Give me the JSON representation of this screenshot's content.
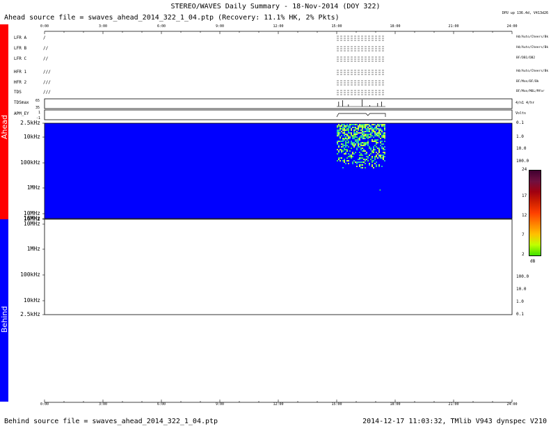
{
  "header": {
    "title": "STEREO/WAVES Daily Summary - 18-Nov-2014 (DOY 322)",
    "ahead_source": "Ahead source file = swaves_ahead_2014_322_1_04.ptp (Recovery: 11.1% HK,  2% Pkts)",
    "dpu_info": "DPU up 136.4d, V413d26"
  },
  "sides": {
    "ahead": "Ahead",
    "behind": "Behind",
    "ahead_color": "#ff0000",
    "behind_color": "#0000ff"
  },
  "time_axis": {
    "ticks": [
      "0:00",
      "3:00",
      "6:00",
      "9:00",
      "12:00",
      "15:00",
      "18:00",
      "21:00",
      "24:00"
    ]
  },
  "instruments": [
    {
      "label": "LFR A",
      "marks": "/"
    },
    {
      "label": "LFR B",
      "marks": "//"
    },
    {
      "label": "LFR C",
      "marks": "//"
    },
    {
      "label": "HFR 1",
      "marks": "///"
    },
    {
      "label": "HFR 2",
      "marks": "///"
    },
    {
      "label": "TDS",
      "marks": "///"
    }
  ],
  "small_panels": {
    "tdsmax": {
      "label": "TDSmax",
      "ticks": [
        "65",
        "35"
      ],
      "right": "4/n1 4/hr"
    },
    "apm": {
      "label": "APM_EY",
      "ticks": [
        "1",
        "-1"
      ],
      "right": "Volts"
    }
  },
  "right_annotations": [
    "Hd/Auto/Cheers/Bk",
    "Hd/Auto/Cheers/Bk",
    "BF/DB1/DB2",
    "Hd/Auto/Cheers/Bk",
    "BF/Mon/BF/Bk",
    "BF/Mon/MOL/Mfor"
  ],
  "ahead_freq_labels": [
    "2.5kHz",
    "10kHz",
    "100kHz",
    "1MHz",
    "10MHz",
    "16MHz"
  ],
  "ahead_right_labels": [
    "0.1",
    "1.0",
    "10.0",
    "100.0"
  ],
  "behind_freq_labels": [
    "16MHz",
    "10MHz",
    "1MHz",
    "100kHz",
    "10kHz",
    "2.5kHz"
  ],
  "behind_right_labels": [
    "100.0",
    "10.0",
    "1.0",
    "0.1"
  ],
  "colorbar": {
    "ticks": [
      "24",
      "17",
      "12",
      "7",
      "2"
    ],
    "unit": "dB",
    "colors": [
      "#400030",
      "#701040",
      "#a00010",
      "#d02000",
      "#ff4000",
      "#ff8000",
      "#ffc000",
      "#c0ff00",
      "#40e000"
    ]
  },
  "chart_data": [
    {
      "type": "heatmap",
      "title": "Ahead",
      "x_ticks": [
        "0:00",
        "3:00",
        "6:00",
        "9:00",
        "12:00",
        "15:00",
        "18:00",
        "21:00",
        "24:00"
      ],
      "xlim_hours": [
        0,
        24
      ],
      "y_ticks": [
        "2.5kHz",
        "10kHz",
        "100kHz",
        "1MHz",
        "10MHz",
        "16MHz"
      ],
      "background_color": "#0000ff",
      "data_interval_hours": [
        15.0,
        17.5
      ],
      "colorbar_db": [
        2,
        24
      ]
    },
    {
      "type": "heatmap",
      "title": "Behind",
      "x_ticks": [
        "0:00",
        "3:00",
        "6:00",
        "9:00",
        "12:00",
        "15:00",
        "18:00",
        "21:00",
        "24:00"
      ],
      "xlim_hours": [
        0,
        24
      ],
      "y_ticks": [
        "16MHz",
        "10MHz",
        "1MHz",
        "100kHz",
        "10kHz",
        "2.5kHz"
      ],
      "background_color": "#ffffff"
    }
  ],
  "footer": {
    "behind_source": "Behind source file = swaves_ahead_2014_322_1_04.ptp",
    "stamp": "2014-12-17 11:03:32, TMlib V943 dynspec V210"
  }
}
